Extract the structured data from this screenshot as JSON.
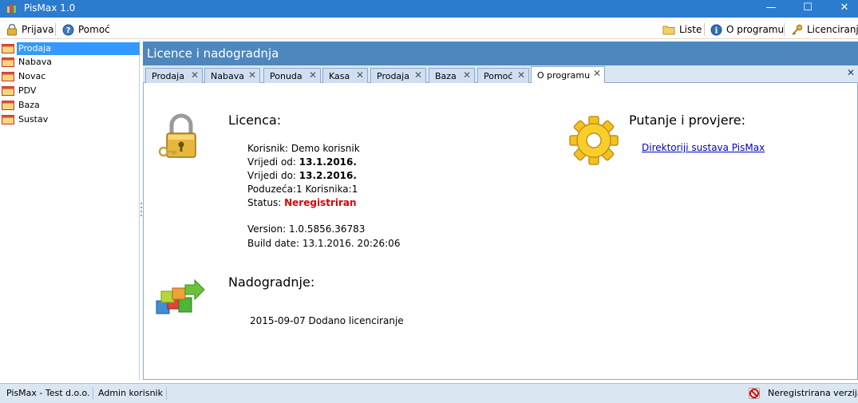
{
  "window": {
    "title": "PisMax 1.0"
  },
  "toolbar": {
    "left": [
      {
        "label": "Prijava",
        "icon": "lock-icon"
      },
      {
        "label": "Pomoć",
        "icon": "help-icon"
      }
    ],
    "right": [
      {
        "label": "Liste",
        "icon": "folder-icon"
      },
      {
        "label": "O programu",
        "icon": "info-icon"
      },
      {
        "label": "Licenciranje",
        "icon": "key-icon"
      }
    ]
  },
  "sidebar": {
    "items": [
      {
        "label": "Prodaja",
        "selected": true
      },
      {
        "label": "Nabava"
      },
      {
        "label": "Novac"
      },
      {
        "label": "PDV"
      },
      {
        "label": "Baza"
      },
      {
        "label": "Sustav"
      }
    ]
  },
  "panel": {
    "title": "Licence i nadogradnja"
  },
  "tabs": [
    {
      "label": "Prodaja"
    },
    {
      "label": "Nabava"
    },
    {
      "label": "Ponuda"
    },
    {
      "label": "Kasa"
    },
    {
      "label": "Prodaja"
    },
    {
      "label": "Baza"
    },
    {
      "label": "Pomoć"
    },
    {
      "label": "O programu",
      "active": true
    }
  ],
  "licence": {
    "heading": "Licenca:",
    "user_label": "Korisnik:",
    "user_value": "Demo korisnik",
    "from_label": "Vrijedi od:",
    "from_value": "13.1.2016.",
    "to_label": "Vrijedi do:",
    "to_value": "13.2.2016.",
    "counts": "Poduzeća:1 Korisnika:1",
    "status_label": "Status:",
    "status_value": "Neregistriran",
    "version": "Version: 1.0.5856.36783",
    "build_date": "Build date: 13.1.2016. 20:26:06"
  },
  "paths": {
    "heading": "Putanje i provjere:",
    "link": "Direktoriji sustava PisMax"
  },
  "upgrades": {
    "heading": "Nadogradnje:",
    "entries": [
      "2015-09-07 Dodano licenciranje"
    ]
  },
  "status": {
    "company": "PisMax - Test d.o.o.",
    "user": "Admin korisnik",
    "registration": "Neregistrirana verzija"
  },
  "colors": {
    "titlebar": "#2b7bcf",
    "panel_header": "#4e87bd",
    "selection": "#3399ff",
    "status_red": "#e00000"
  }
}
